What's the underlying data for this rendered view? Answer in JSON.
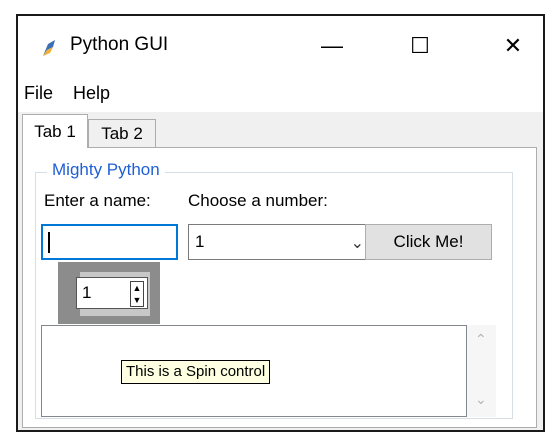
{
  "window": {
    "title": "Python GUI",
    "min_glyph": "—",
    "max_glyph": "☐",
    "close_glyph": "✕"
  },
  "menubar": {
    "items": [
      {
        "label": "File"
      },
      {
        "label": "Help"
      }
    ]
  },
  "tabs": [
    {
      "label": "Tab 1",
      "selected": true
    },
    {
      "label": "Tab 2",
      "selected": false
    }
  ],
  "group": {
    "title": "Mighty Python",
    "name_label": "Enter a name:",
    "number_label": "Choose a number:",
    "name_value": "",
    "number_value": "1",
    "button_label": "Click Me!",
    "spin_value": "1"
  },
  "scrolled_text": {
    "value": ""
  },
  "tooltip": {
    "text": "This is a Spin control"
  },
  "colors": {
    "accent_focus": "#0078d7",
    "group_title": "#1f5fd6",
    "tooltip_bg": "#ffffe1"
  },
  "icons": {
    "app": "python-feather-icon",
    "combo_arrow": "chevron-down-icon",
    "spin_arrows": "spin-arrows-icon"
  }
}
